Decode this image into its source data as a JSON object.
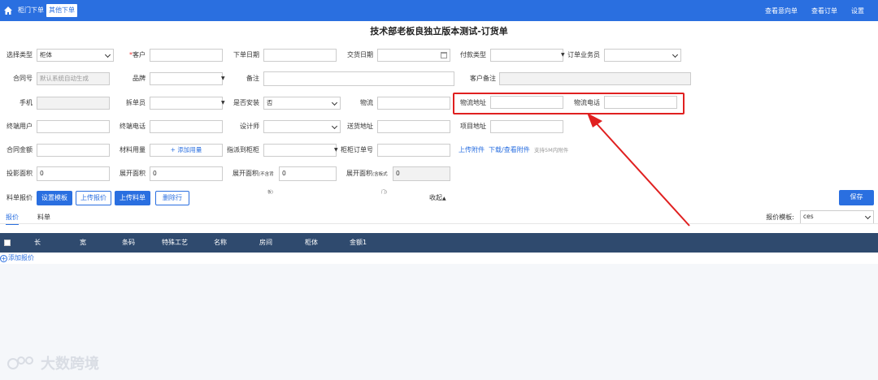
{
  "topbar": {
    "tabs": [
      {
        "label": "柜门下单",
        "active": false
      },
      {
        "label": "其他下单",
        "active": true
      }
    ],
    "right_links": [
      "查看意向单",
      "查看订单",
      "设置"
    ]
  },
  "page_title": "技术部老板良独立版本测试-订货单",
  "form": {
    "select_type": {
      "label": "选择类型",
      "value": "柜体"
    },
    "customer": {
      "label": "客户",
      "required_mark": "*",
      "value": ""
    },
    "order_date": {
      "label": "下单日期",
      "value": ""
    },
    "delivery_date": {
      "label": "交货日期",
      "value": ""
    },
    "payment_type": {
      "label": "付款类型",
      "value": ""
    },
    "order_salesman": {
      "label": "订单业务员",
      "value": ""
    },
    "contract_no": {
      "label": "合同号",
      "placeholder": "默认系统自动生成"
    },
    "brand": {
      "label": "品牌",
      "value": ""
    },
    "remark": {
      "label": "备注",
      "value": ""
    },
    "customer_remark": {
      "label": "客户备注",
      "value": ""
    },
    "phone": {
      "label": "手机",
      "value": ""
    },
    "order_splitter": {
      "label": "拆单员",
      "value": ""
    },
    "install": {
      "label": "是否安装",
      "value": "否"
    },
    "logistics": {
      "label": "物流",
      "value": ""
    },
    "logistics_address": {
      "label": "物流地址",
      "value": ""
    },
    "logistics_phone": {
      "label": "物流电话",
      "value": ""
    },
    "end_user": {
      "label": "终端用户",
      "value": ""
    },
    "end_phone": {
      "label": "终端电话",
      "value": ""
    },
    "designer": {
      "label": "设计师",
      "value": ""
    },
    "shipping_address": {
      "label": "送货地址",
      "value": ""
    },
    "project_address": {
      "label": "项目地址",
      "value": ""
    },
    "contract_amount": {
      "label": "合同金额",
      "value": ""
    },
    "material_usage": {
      "label": "材料用量",
      "add_label": "+ 添加用量"
    },
    "assign_cabinet": {
      "label": "指派到柜柜",
      "value": ""
    },
    "cabinet_order_no": {
      "label": "柜柜订单号",
      "value": ""
    },
    "upload_attachment": "上传附件",
    "download_attachment": "下载/查看附件",
    "attachment_hint": "支持5M内附件",
    "projection_area": {
      "label": "投影面积",
      "value": "0"
    },
    "unfold_area": {
      "label": "展开面积",
      "value": "0"
    },
    "unfold_area_no_door": {
      "label": "展开面积",
      "suffix": "(不含背",
      "tail": "板)",
      "value": "0"
    },
    "unfold_area_with": {
      "label": "展开面积",
      "suffix": "(含板式",
      "tail": "门)",
      "value": "0"
    }
  },
  "toolbar": {
    "label": "料单报价",
    "buttons": [
      "设置模板",
      "上传报价",
      "上传料单",
      "删除行"
    ],
    "collapse": "收起",
    "save": "保存"
  },
  "subtabs": [
    {
      "label": "报价",
      "active": true
    },
    {
      "label": "料单",
      "active": false
    }
  ],
  "quote_template": {
    "label": "报价模板:",
    "value": "ces"
  },
  "table": {
    "columns": [
      "长",
      "宽",
      "条码",
      "特殊工艺",
      "名称",
      "房间",
      "柜体",
      "金额1"
    ],
    "add_row": "添加报价"
  },
  "watermark": "大数跨境",
  "colors": {
    "primary": "#2a6fe0",
    "table_header": "#2f4a6e",
    "highlight": "#e02020"
  }
}
